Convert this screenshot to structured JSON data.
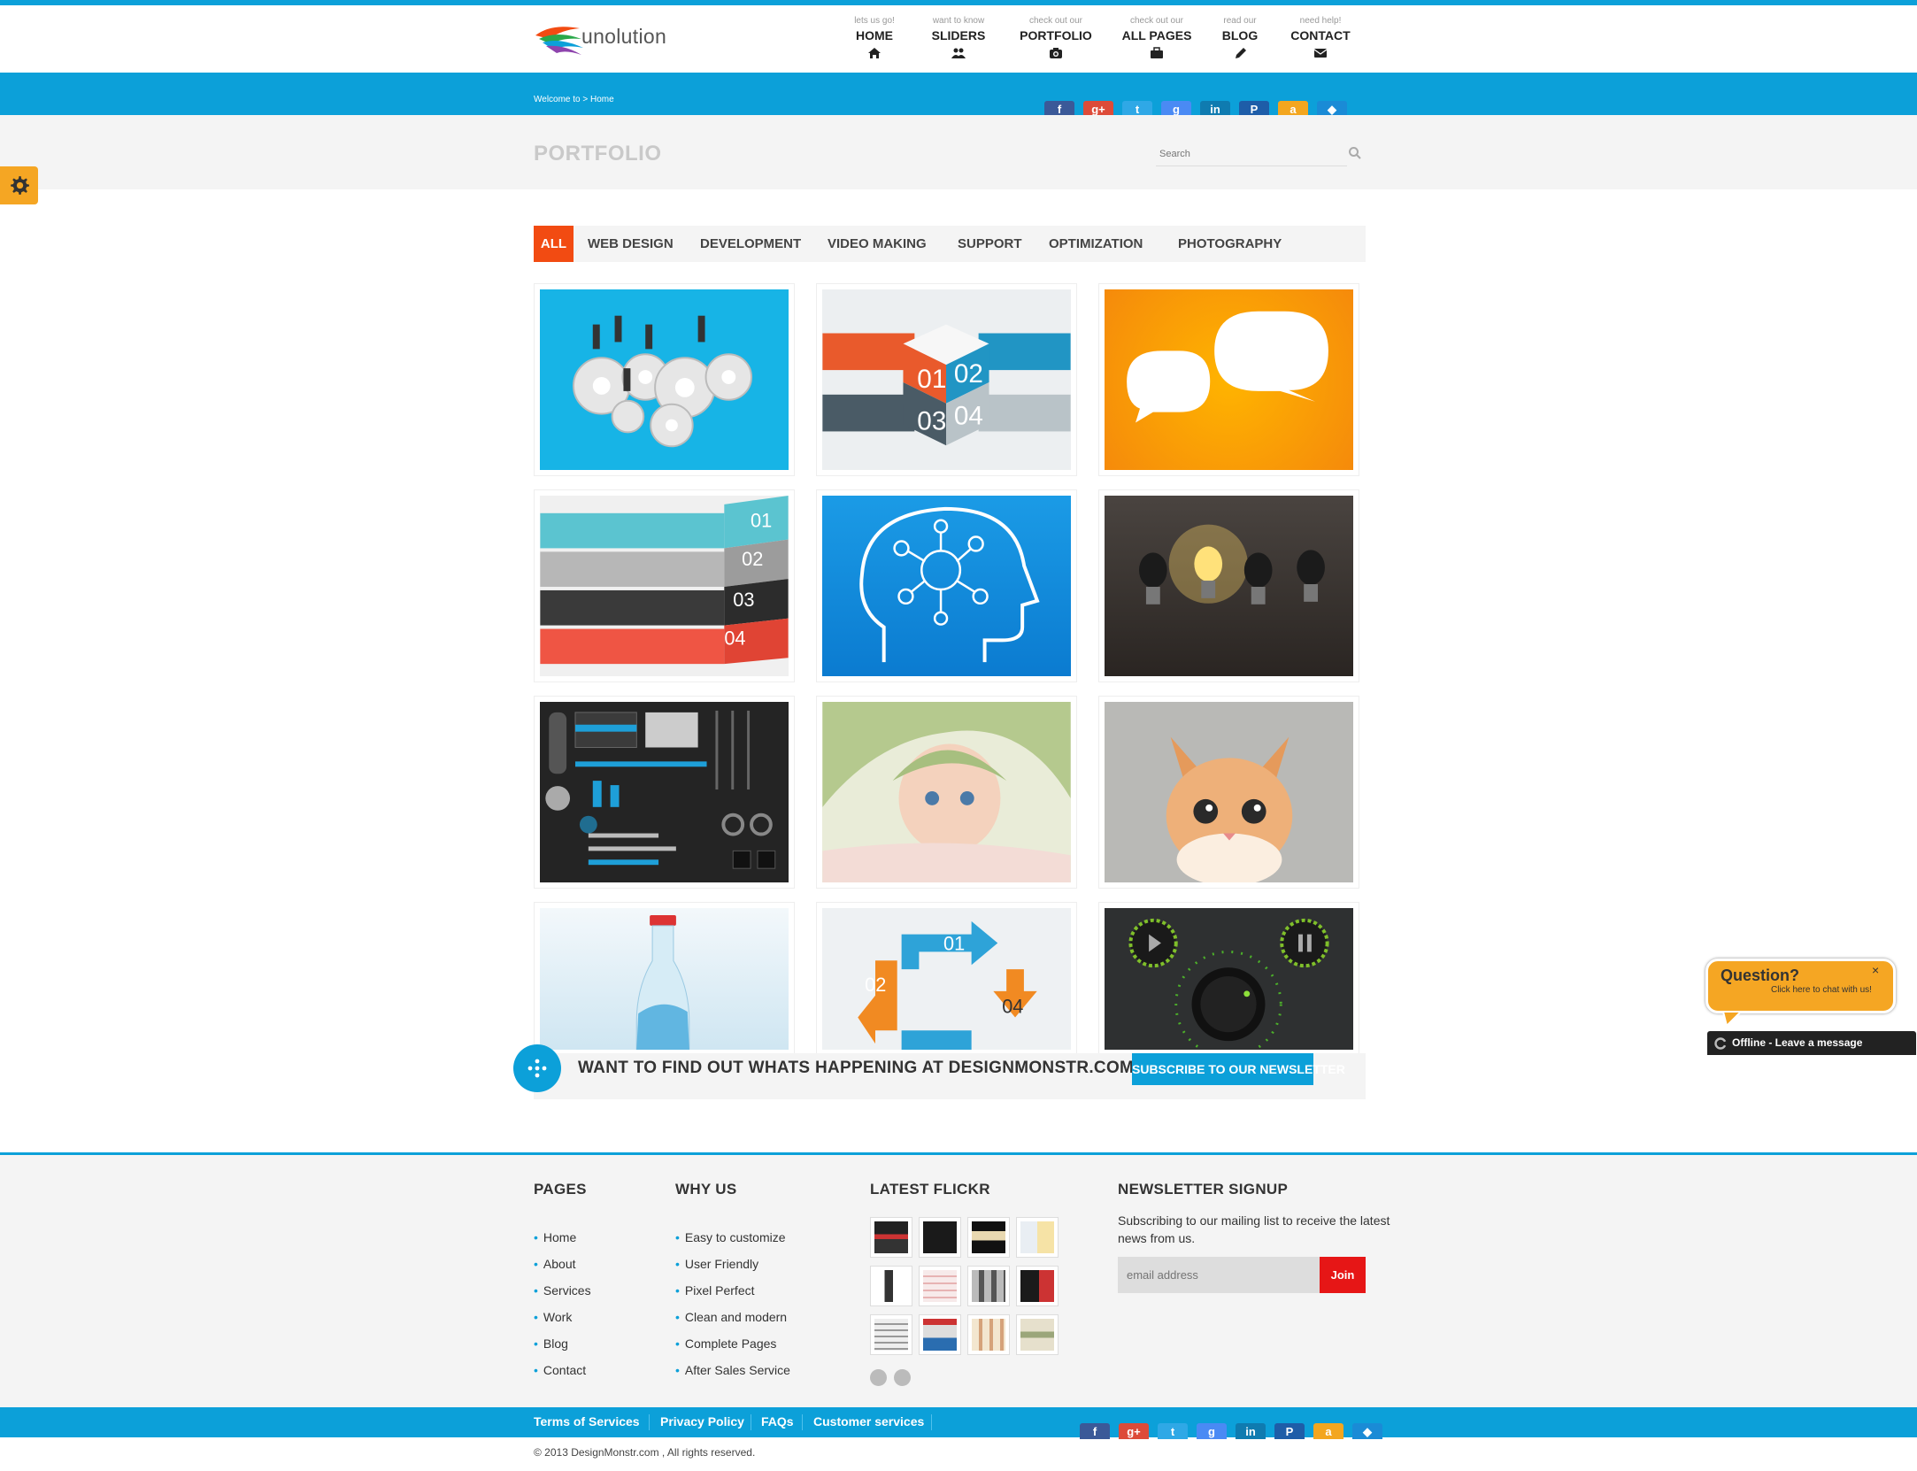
{
  "brand": {
    "logo_text": "unolution"
  },
  "nav": [
    {
      "sub": "lets us go!",
      "label": "HOME",
      "icon": "home-icon"
    },
    {
      "sub": "want to know",
      "label": "SLIDERS",
      "icon": "users-icon"
    },
    {
      "sub": "check out our",
      "label": "PORTFOLIO",
      "icon": "camera-icon"
    },
    {
      "sub": "check out our",
      "label": "ALL PAGES",
      "icon": "briefcase-icon"
    },
    {
      "sub": "read our",
      "label": "BLOG",
      "icon": "pencil-icon"
    },
    {
      "sub": "need help!",
      "label": "CONTACT",
      "icon": "envelope-icon"
    }
  ],
  "breadcrumb": "Welcome to > Home",
  "social": [
    {
      "icon": "facebook-icon",
      "glyph": "f",
      "color": "#3b5998"
    },
    {
      "icon": "googleplus-icon",
      "glyph": "g+",
      "color": "#dd4b39"
    },
    {
      "icon": "twitter-icon",
      "glyph": "t",
      "color": "#2fa8e6"
    },
    {
      "icon": "google-icon",
      "glyph": "g",
      "color": "#4a8af4"
    },
    {
      "icon": "linkedin-icon",
      "glyph": "in",
      "color": "#0f7bb0"
    },
    {
      "icon": "paypal-icon",
      "glyph": "P",
      "color": "#1e5da8"
    },
    {
      "icon": "amazon-icon",
      "glyph": "a",
      "color": "#f3a61f"
    },
    {
      "icon": "dropbox-icon",
      "glyph": "◆",
      "color": "#1a8bd6"
    }
  ],
  "page_title": "PORTFOLIO",
  "search": {
    "placeholder": "Search"
  },
  "filters": [
    "ALL",
    "WEB DESIGN",
    "DEVELOPMENT",
    "VIDEO MAKING",
    "SUPPORT",
    "OPTIMIZATION",
    "PHOTOGRAPHY"
  ],
  "portfolio": [
    {
      "name": "gears-business"
    },
    {
      "name": "infographic-cube",
      "labels": [
        "01",
        "02",
        "03",
        "04"
      ]
    },
    {
      "name": "speech-bubbles"
    },
    {
      "name": "infographic-steps",
      "labels": [
        "01",
        "02",
        "03",
        "04"
      ]
    },
    {
      "name": "head-network"
    },
    {
      "name": "light-bulbs"
    },
    {
      "name": "ui-kit-dark"
    },
    {
      "name": "baby-photo"
    },
    {
      "name": "kitten-photo"
    },
    {
      "name": "water-bottle"
    },
    {
      "name": "infographic-arrows",
      "labels": [
        "01",
        "02",
        "04"
      ]
    },
    {
      "name": "audio-knob"
    }
  ],
  "newsletter_banner": {
    "text": "WANT TO FIND OUT WHATS HAPPENING AT DESIGNMONSTR.COM",
    "button": "SUBSCRIBE TO OUR NEWSLETTER"
  },
  "chat": {
    "title": "Question?",
    "subtitle": "Click here to chat with us!",
    "close": "×",
    "status": "Offline - Leave a message"
  },
  "footer": {
    "pages": {
      "heading": "PAGES",
      "links": [
        "Home",
        "About",
        "Services",
        "Work",
        "Blog",
        "Contact"
      ]
    },
    "why_us": {
      "heading": "WHY US",
      "items": [
        "Easy to customize",
        "User Friendly",
        "Pixel Perfect",
        "Clean and modern",
        "Complete Pages",
        "After Sales Service"
      ]
    },
    "flickr": {
      "heading": "LATEST FLICKR"
    },
    "newsletter": {
      "heading": "NEWSLETTER SIGNUP",
      "description": "Subscribing to our mailing list to receive the latest news from us.",
      "placeholder": "email address",
      "button": "Join"
    }
  },
  "bottom_links": [
    "Terms of Services",
    "Privacy Policy",
    "FAQs",
    "Customer services"
  ],
  "copyright": "© 2013 DesignMonstr.com , All rights reserved.",
  "colors": {
    "accent": "#0ca0d9",
    "filter_active": "#f24b12",
    "join": "#e61616",
    "chat": "#f5a623"
  }
}
